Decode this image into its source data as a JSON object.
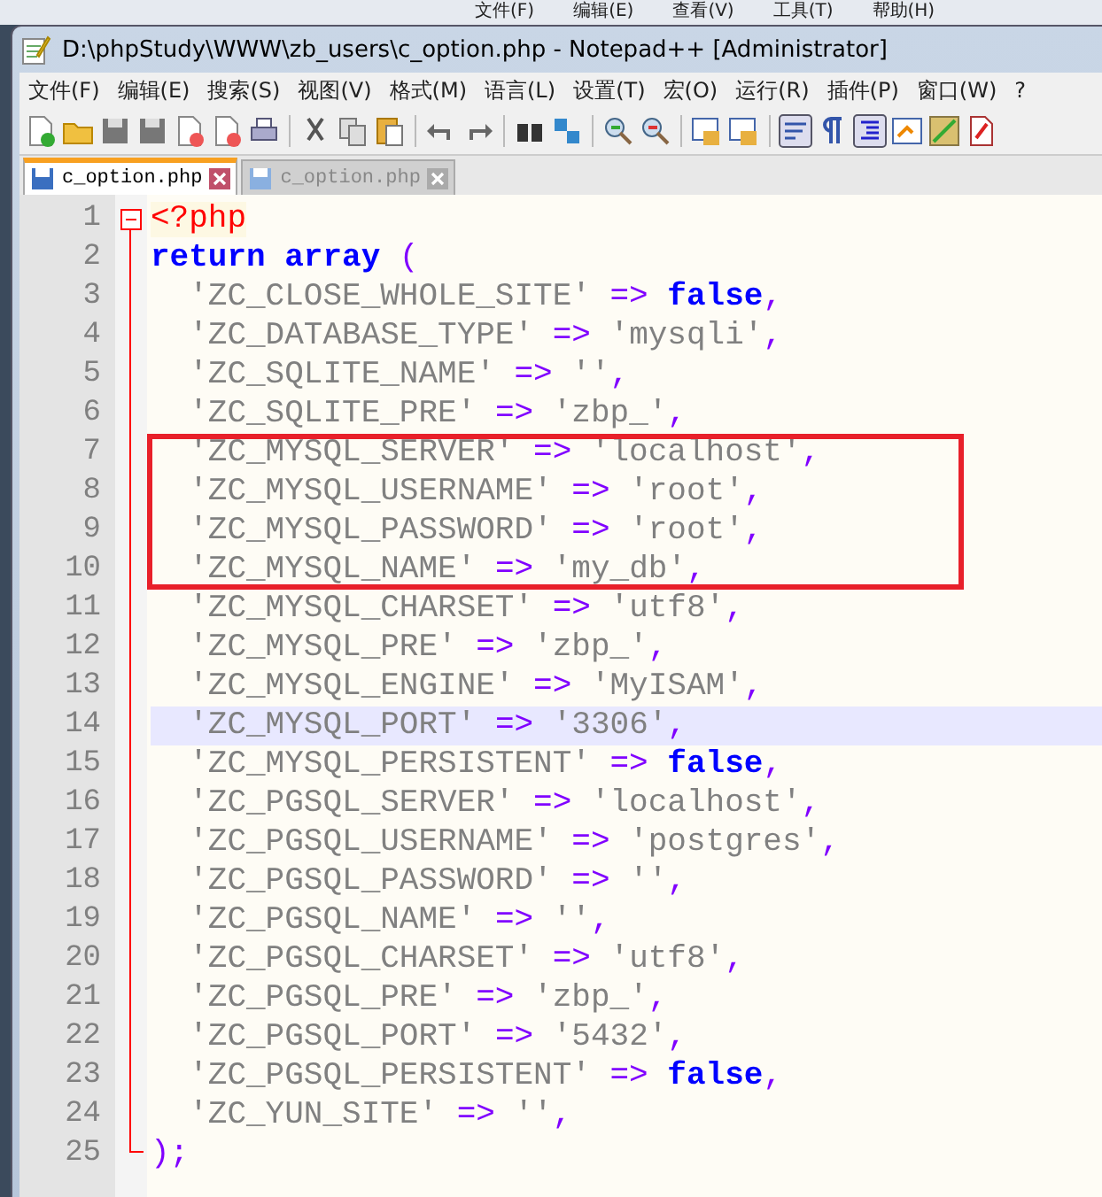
{
  "background_window": {
    "menu": [
      "文件(F)",
      "编辑(E)",
      "查看(V)",
      "工具(T)",
      "帮助(H)"
    ]
  },
  "window": {
    "title": "D:\\phpStudy\\WWW\\zb_users\\c_option.php - Notepad++ [Administrator]"
  },
  "menu": [
    "文件(F)",
    "编辑(E)",
    "搜索(S)",
    "视图(V)",
    "格式(M)",
    "语言(L)",
    "设置(T)",
    "宏(O)",
    "运行(R)",
    "插件(P)",
    "窗口(W)",
    "?"
  ],
  "tabs": [
    {
      "label": "c_option.php",
      "selected": true
    },
    {
      "label": "c_option.php",
      "selected": false
    }
  ],
  "editor": {
    "lines": [
      {
        "number": "1",
        "current": false,
        "annotated": false,
        "tokens": [
          {
            "kind": "tag",
            "text": "<?php"
          }
        ]
      },
      {
        "number": "2",
        "current": false,
        "annotated": false,
        "tokens": [
          {
            "kind": "keyword",
            "text": "return array"
          },
          {
            "kind": "op",
            "text": " ("
          }
        ]
      },
      {
        "number": "3",
        "current": false,
        "annotated": false,
        "tokens": [
          {
            "kind": "string",
            "text": "  'ZC_CLOSE_WHOLE_SITE'"
          },
          {
            "kind": "op",
            "text": " => "
          },
          {
            "kind": "keyword",
            "text": "false"
          },
          {
            "kind": "op",
            "text": ","
          }
        ]
      },
      {
        "number": "4",
        "current": false,
        "annotated": false,
        "tokens": [
          {
            "kind": "string",
            "text": "  'ZC_DATABASE_TYPE'"
          },
          {
            "kind": "op",
            "text": " => "
          },
          {
            "kind": "string",
            "text": "'mysqli'"
          },
          {
            "kind": "op",
            "text": ","
          }
        ]
      },
      {
        "number": "5",
        "current": false,
        "annotated": false,
        "tokens": [
          {
            "kind": "string",
            "text": "  'ZC_SQLITE_NAME'"
          },
          {
            "kind": "op",
            "text": " => "
          },
          {
            "kind": "string",
            "text": "''"
          },
          {
            "kind": "op",
            "text": ","
          }
        ]
      },
      {
        "number": "6",
        "current": false,
        "annotated": false,
        "tokens": [
          {
            "kind": "string",
            "text": "  'ZC_SQLITE_PRE'"
          },
          {
            "kind": "op",
            "text": " => "
          },
          {
            "kind": "string",
            "text": "'zbp_'"
          },
          {
            "kind": "op",
            "text": ","
          }
        ]
      },
      {
        "number": "7",
        "current": false,
        "annotated": true,
        "tokens": [
          {
            "kind": "string",
            "text": "  'ZC_MYSQL_SERVER'"
          },
          {
            "kind": "op",
            "text": " => "
          },
          {
            "kind": "string",
            "text": "'localhost'"
          },
          {
            "kind": "op",
            "text": ","
          }
        ]
      },
      {
        "number": "8",
        "current": false,
        "annotated": true,
        "tokens": [
          {
            "kind": "string",
            "text": "  'ZC_MYSQL_USERNAME'"
          },
          {
            "kind": "op",
            "text": " => "
          },
          {
            "kind": "string",
            "text": "'root'"
          },
          {
            "kind": "op",
            "text": ","
          }
        ]
      },
      {
        "number": "9",
        "current": false,
        "annotated": true,
        "tokens": [
          {
            "kind": "string",
            "text": "  'ZC_MYSQL_PASSWORD'"
          },
          {
            "kind": "op",
            "text": " => "
          },
          {
            "kind": "string",
            "text": "'root'"
          },
          {
            "kind": "op",
            "text": ","
          }
        ]
      },
      {
        "number": "10",
        "current": false,
        "annotated": true,
        "tokens": [
          {
            "kind": "string",
            "text": "  'ZC_MYSQL_NAME'"
          },
          {
            "kind": "op",
            "text": " => "
          },
          {
            "kind": "string",
            "text": "'my_db'"
          },
          {
            "kind": "op",
            "text": ","
          }
        ]
      },
      {
        "number": "11",
        "current": false,
        "annotated": false,
        "tokens": [
          {
            "kind": "string",
            "text": "  'ZC_MYSQL_CHARSET'"
          },
          {
            "kind": "op",
            "text": " => "
          },
          {
            "kind": "string",
            "text": "'utf8'"
          },
          {
            "kind": "op",
            "text": ","
          }
        ]
      },
      {
        "number": "12",
        "current": false,
        "annotated": false,
        "tokens": [
          {
            "kind": "string",
            "text": "  'ZC_MYSQL_PRE'"
          },
          {
            "kind": "op",
            "text": " => "
          },
          {
            "kind": "string",
            "text": "'zbp_'"
          },
          {
            "kind": "op",
            "text": ","
          }
        ]
      },
      {
        "number": "13",
        "current": false,
        "annotated": false,
        "tokens": [
          {
            "kind": "string",
            "text": "  'ZC_MYSQL_ENGINE'"
          },
          {
            "kind": "op",
            "text": " => "
          },
          {
            "kind": "string",
            "text": "'MyISAM'"
          },
          {
            "kind": "op",
            "text": ","
          }
        ]
      },
      {
        "number": "14",
        "current": true,
        "annotated": false,
        "tokens": [
          {
            "kind": "string",
            "text": "  'ZC_MYSQL_PORT'"
          },
          {
            "kind": "op",
            "text": " => "
          },
          {
            "kind": "string",
            "text": "'3306'"
          },
          {
            "kind": "op",
            "text": ","
          }
        ]
      },
      {
        "number": "15",
        "current": false,
        "annotated": false,
        "tokens": [
          {
            "kind": "string",
            "text": "  'ZC_MYSQL_PERSISTENT'"
          },
          {
            "kind": "op",
            "text": " => "
          },
          {
            "kind": "keyword",
            "text": "false"
          },
          {
            "kind": "op",
            "text": ","
          }
        ]
      },
      {
        "number": "16",
        "current": false,
        "annotated": false,
        "tokens": [
          {
            "kind": "string",
            "text": "  'ZC_PGSQL_SERVER'"
          },
          {
            "kind": "op",
            "text": " => "
          },
          {
            "kind": "string",
            "text": "'localhost'"
          },
          {
            "kind": "op",
            "text": ","
          }
        ]
      },
      {
        "number": "17",
        "current": false,
        "annotated": false,
        "tokens": [
          {
            "kind": "string",
            "text": "  'ZC_PGSQL_USERNAME'"
          },
          {
            "kind": "op",
            "text": " => "
          },
          {
            "kind": "string",
            "text": "'postgres'"
          },
          {
            "kind": "op",
            "text": ","
          }
        ]
      },
      {
        "number": "18",
        "current": false,
        "annotated": false,
        "tokens": [
          {
            "kind": "string",
            "text": "  'ZC_PGSQL_PASSWORD'"
          },
          {
            "kind": "op",
            "text": " => "
          },
          {
            "kind": "string",
            "text": "''"
          },
          {
            "kind": "op",
            "text": ","
          }
        ]
      },
      {
        "number": "19",
        "current": false,
        "annotated": false,
        "tokens": [
          {
            "kind": "string",
            "text": "  'ZC_PGSQL_NAME'"
          },
          {
            "kind": "op",
            "text": " => "
          },
          {
            "kind": "string",
            "text": "''"
          },
          {
            "kind": "op",
            "text": ","
          }
        ]
      },
      {
        "number": "20",
        "current": false,
        "annotated": false,
        "tokens": [
          {
            "kind": "string",
            "text": "  'ZC_PGSQL_CHARSET'"
          },
          {
            "kind": "op",
            "text": " => "
          },
          {
            "kind": "string",
            "text": "'utf8'"
          },
          {
            "kind": "op",
            "text": ","
          }
        ]
      },
      {
        "number": "21",
        "current": false,
        "annotated": false,
        "tokens": [
          {
            "kind": "string",
            "text": "  'ZC_PGSQL_PRE'"
          },
          {
            "kind": "op",
            "text": " => "
          },
          {
            "kind": "string",
            "text": "'zbp_'"
          },
          {
            "kind": "op",
            "text": ","
          }
        ]
      },
      {
        "number": "22",
        "current": false,
        "annotated": false,
        "tokens": [
          {
            "kind": "string",
            "text": "  'ZC_PGSQL_PORT'"
          },
          {
            "kind": "op",
            "text": " => "
          },
          {
            "kind": "string",
            "text": "'5432'"
          },
          {
            "kind": "op",
            "text": ","
          }
        ]
      },
      {
        "number": "23",
        "current": false,
        "annotated": false,
        "tokens": [
          {
            "kind": "string",
            "text": "  'ZC_PGSQL_PERSISTENT'"
          },
          {
            "kind": "op",
            "text": " => "
          },
          {
            "kind": "keyword",
            "text": "false"
          },
          {
            "kind": "op",
            "text": ","
          }
        ]
      },
      {
        "number": "24",
        "current": false,
        "annotated": false,
        "tokens": [
          {
            "kind": "string",
            "text": "  'ZC_YUN_SITE'"
          },
          {
            "kind": "op",
            "text": " => "
          },
          {
            "kind": "string",
            "text": "''"
          },
          {
            "kind": "op",
            "text": ","
          }
        ]
      },
      {
        "number": "25",
        "current": false,
        "annotated": false,
        "tokens": [
          {
            "kind": "op",
            "text": ");"
          }
        ]
      }
    ]
  }
}
